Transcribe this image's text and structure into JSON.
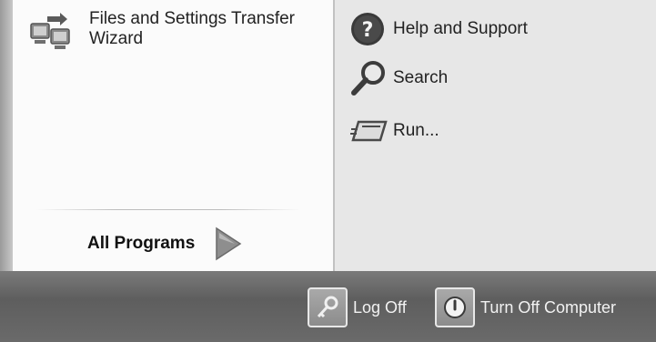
{
  "left_pane": {
    "pinned_item": {
      "label_line1": "Files and Settings Transfer",
      "label_line2": "Wizard",
      "icon": "transfer-wizard-icon"
    },
    "all_programs": {
      "label": "All Programs",
      "icon": "green-arrow-icon"
    }
  },
  "right_pane": {
    "items": [
      {
        "label": "Help and Support",
        "icon": "help-icon"
      },
      {
        "label": "Search",
        "icon": "search-icon"
      },
      {
        "label": "Run...",
        "icon": "run-icon"
      }
    ]
  },
  "bottom_bar": {
    "log_off_label": "Log Off",
    "log_off_icon": "key-icon",
    "turn_off_label": "Turn Off Computer",
    "turn_off_icon": "power-icon"
  }
}
